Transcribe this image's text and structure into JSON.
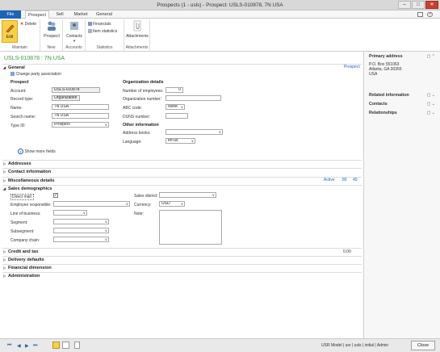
{
  "window": {
    "title": "Prospects (1 - usls) - Prospect: USLS-010878, 7N USA"
  },
  "tabs": {
    "file": "File",
    "prospect": "Prospect",
    "sell": "Sell",
    "market": "Market",
    "general": "General"
  },
  "ribbon": {
    "edit": "Edit",
    "delete": "Delete",
    "maintain": "Maintain",
    "prospect": "Prospect",
    "new": "New",
    "contacts": "Contacts",
    "accounts": "Accounts",
    "financials": "Financials",
    "item_statistics": "Item statistics",
    "statistics": "Statistics",
    "attachments_btn": "Attachments",
    "attachments": "Attachments"
  },
  "record": {
    "heading": "USLS-010878 : 7N USA"
  },
  "general": {
    "title": "General",
    "prospect_link": "Prospect",
    "change_party": "Change party association",
    "prospect_hdr": "Prospect",
    "account_lbl": "Account:",
    "account_val": "USLS-010878",
    "record_type_lbl": "Record type:",
    "record_type_val": "Organization",
    "name_lbl": "Name:",
    "name_val": "7N USA",
    "search_name_lbl": "Search name:",
    "search_name_val": "7N USA",
    "type_id_lbl": "Type ID:",
    "type_id_val": "Prospect",
    "org_hdr": "Organization details",
    "employees_lbl": "Number of employees:",
    "employees_val": "0",
    "org_number_lbl": "Organization number:",
    "abc_lbl": "ABC code:",
    "abc_val": "None",
    "duns_lbl": "DUNS number:",
    "other_hdr": "Other information",
    "address_books_lbl": "Address books:",
    "language_lbl": "Language:",
    "language_val": "en-us",
    "show_more": "Show more fields"
  },
  "sections": {
    "addresses": "Addresses",
    "contact_info": "Contact information",
    "misc": "Miscellaneous details",
    "misc_status": "Active",
    "misc_n1": "80",
    "misc_n2": "40",
    "sales_demo": "Sales demographics",
    "credit": "Credit and tax",
    "credit_val": "0.00",
    "delivery": "Delivery defaults",
    "financial": "Financial dimension",
    "admin": "Administration"
  },
  "sales": {
    "direct_mail_lbl": "Direct mail:",
    "direct_mail_checked": "✓",
    "employee_resp_lbl": "Employee responsible:",
    "lob_lbl": "Line of business:",
    "segment_lbl": "Segment:",
    "subsegment_lbl": "Subsegment:",
    "company_chain_lbl": "Company chain:",
    "sales_district_lbl": "Sales district:",
    "currency_lbl": "Currency:",
    "currency_val": "USD",
    "note_lbl": "Note:"
  },
  "factbox": {
    "primary_address": "Primary address",
    "addr1": "P.O. Box 551063",
    "addr2": "Atlanta, GA 30355",
    "addr3": "USA",
    "related": "Related information",
    "contacts": "Contacts",
    "relationships": "Relationships"
  },
  "status": {
    "text": "USR Model | usr | usls | initial | Admin",
    "close": "Close"
  }
}
